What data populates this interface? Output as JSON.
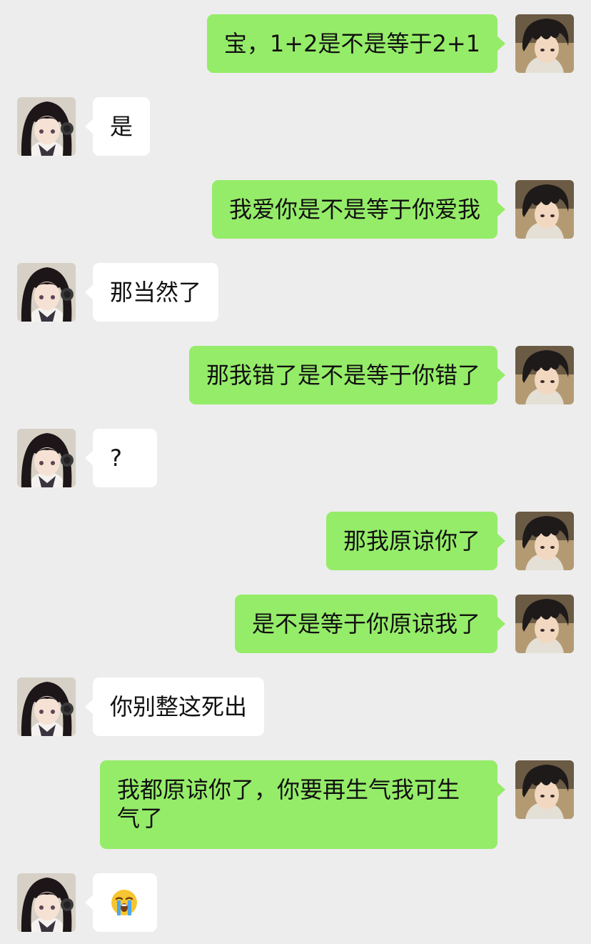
{
  "chat": {
    "colors": {
      "background": "#ededed",
      "outgoing_bubble": "#95ec69",
      "incoming_bubble": "#ffffff"
    },
    "messages": [
      {
        "sender": "me",
        "text": "宝，1+2是不是等于2+1"
      },
      {
        "sender": "her",
        "text": "是"
      },
      {
        "sender": "me",
        "text": "我爱你是不是等于你爱我"
      },
      {
        "sender": "her",
        "text": "那当然了"
      },
      {
        "sender": "me",
        "text": "那我错了是不是等于你错了"
      },
      {
        "sender": "her",
        "text": "?"
      },
      {
        "sender": "me",
        "text": "那我原谅你了"
      },
      {
        "sender": "me",
        "text": "是不是等于你原谅我了"
      },
      {
        "sender": "her",
        "text": "你别整这死出"
      },
      {
        "sender": "me",
        "text": "我都原谅你了，你要再生气我可生\n气了"
      },
      {
        "sender": "her",
        "emoji": "loudly-crying-face"
      }
    ]
  }
}
